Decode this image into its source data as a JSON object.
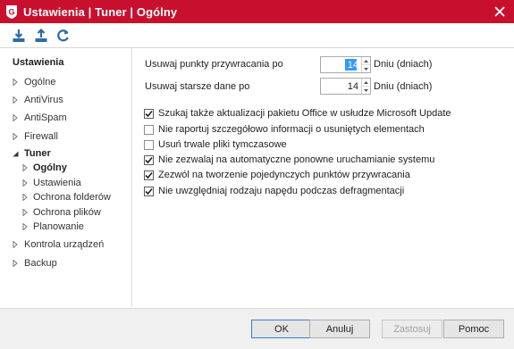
{
  "window": {
    "title": "Ustawienia | Tuner | Ogólny"
  },
  "toolbar": {
    "icons": [
      "import-icon",
      "export-icon",
      "restore-defaults-icon"
    ]
  },
  "sidebar": {
    "heading": "Ustawienia",
    "items": [
      {
        "label": "Ogólne"
      },
      {
        "label": "AntiVirus"
      },
      {
        "label": "AntiSpam"
      },
      {
        "label": "Firewall"
      },
      {
        "label": "Tuner",
        "expanded": true
      },
      {
        "label": "Kontrola urządzeń"
      },
      {
        "label": "Backup"
      }
    ],
    "subitems": [
      {
        "label": "Ogólny",
        "selected": true
      },
      {
        "label": "Ustawienia"
      },
      {
        "label": "Ochrona folderów"
      },
      {
        "label": "Ochrona plików"
      },
      {
        "label": "Planowanie"
      }
    ]
  },
  "settings": {
    "restore_points": {
      "label": "Usuwaj punkty przywracania po",
      "value": "14",
      "unit": "Dniu (dniach)"
    },
    "old_data": {
      "label": "Usuwaj starsze dane po",
      "value": "14",
      "unit": "Dniu (dniach)"
    },
    "checkboxes": [
      {
        "label": "Szukaj także aktualizacji pakietu Office w usłudze Microsoft Update",
        "checked": true
      },
      {
        "label": "Nie raportuj szczegółowo informacji o usuniętych elementach",
        "checked": false
      },
      {
        "label": "Usuń trwale pliki tymczasowe",
        "checked": false
      },
      {
        "label": "Nie zezwalaj na automatyczne ponowne uruchamianie systemu",
        "checked": true
      },
      {
        "label": "Zezwól na tworzenie pojedynczych punktów przywracania",
        "checked": true
      },
      {
        "label": "Nie uwzględniaj rodzaju napędu podczas defragmentacji",
        "checked": true
      }
    ]
  },
  "footer": {
    "ok": "OK",
    "cancel": "Anuluj",
    "apply": "Zastosuj",
    "help": "Pomoc"
  },
  "colors": {
    "titlebar": "#c8102e",
    "accent": "#2a6ca8"
  }
}
